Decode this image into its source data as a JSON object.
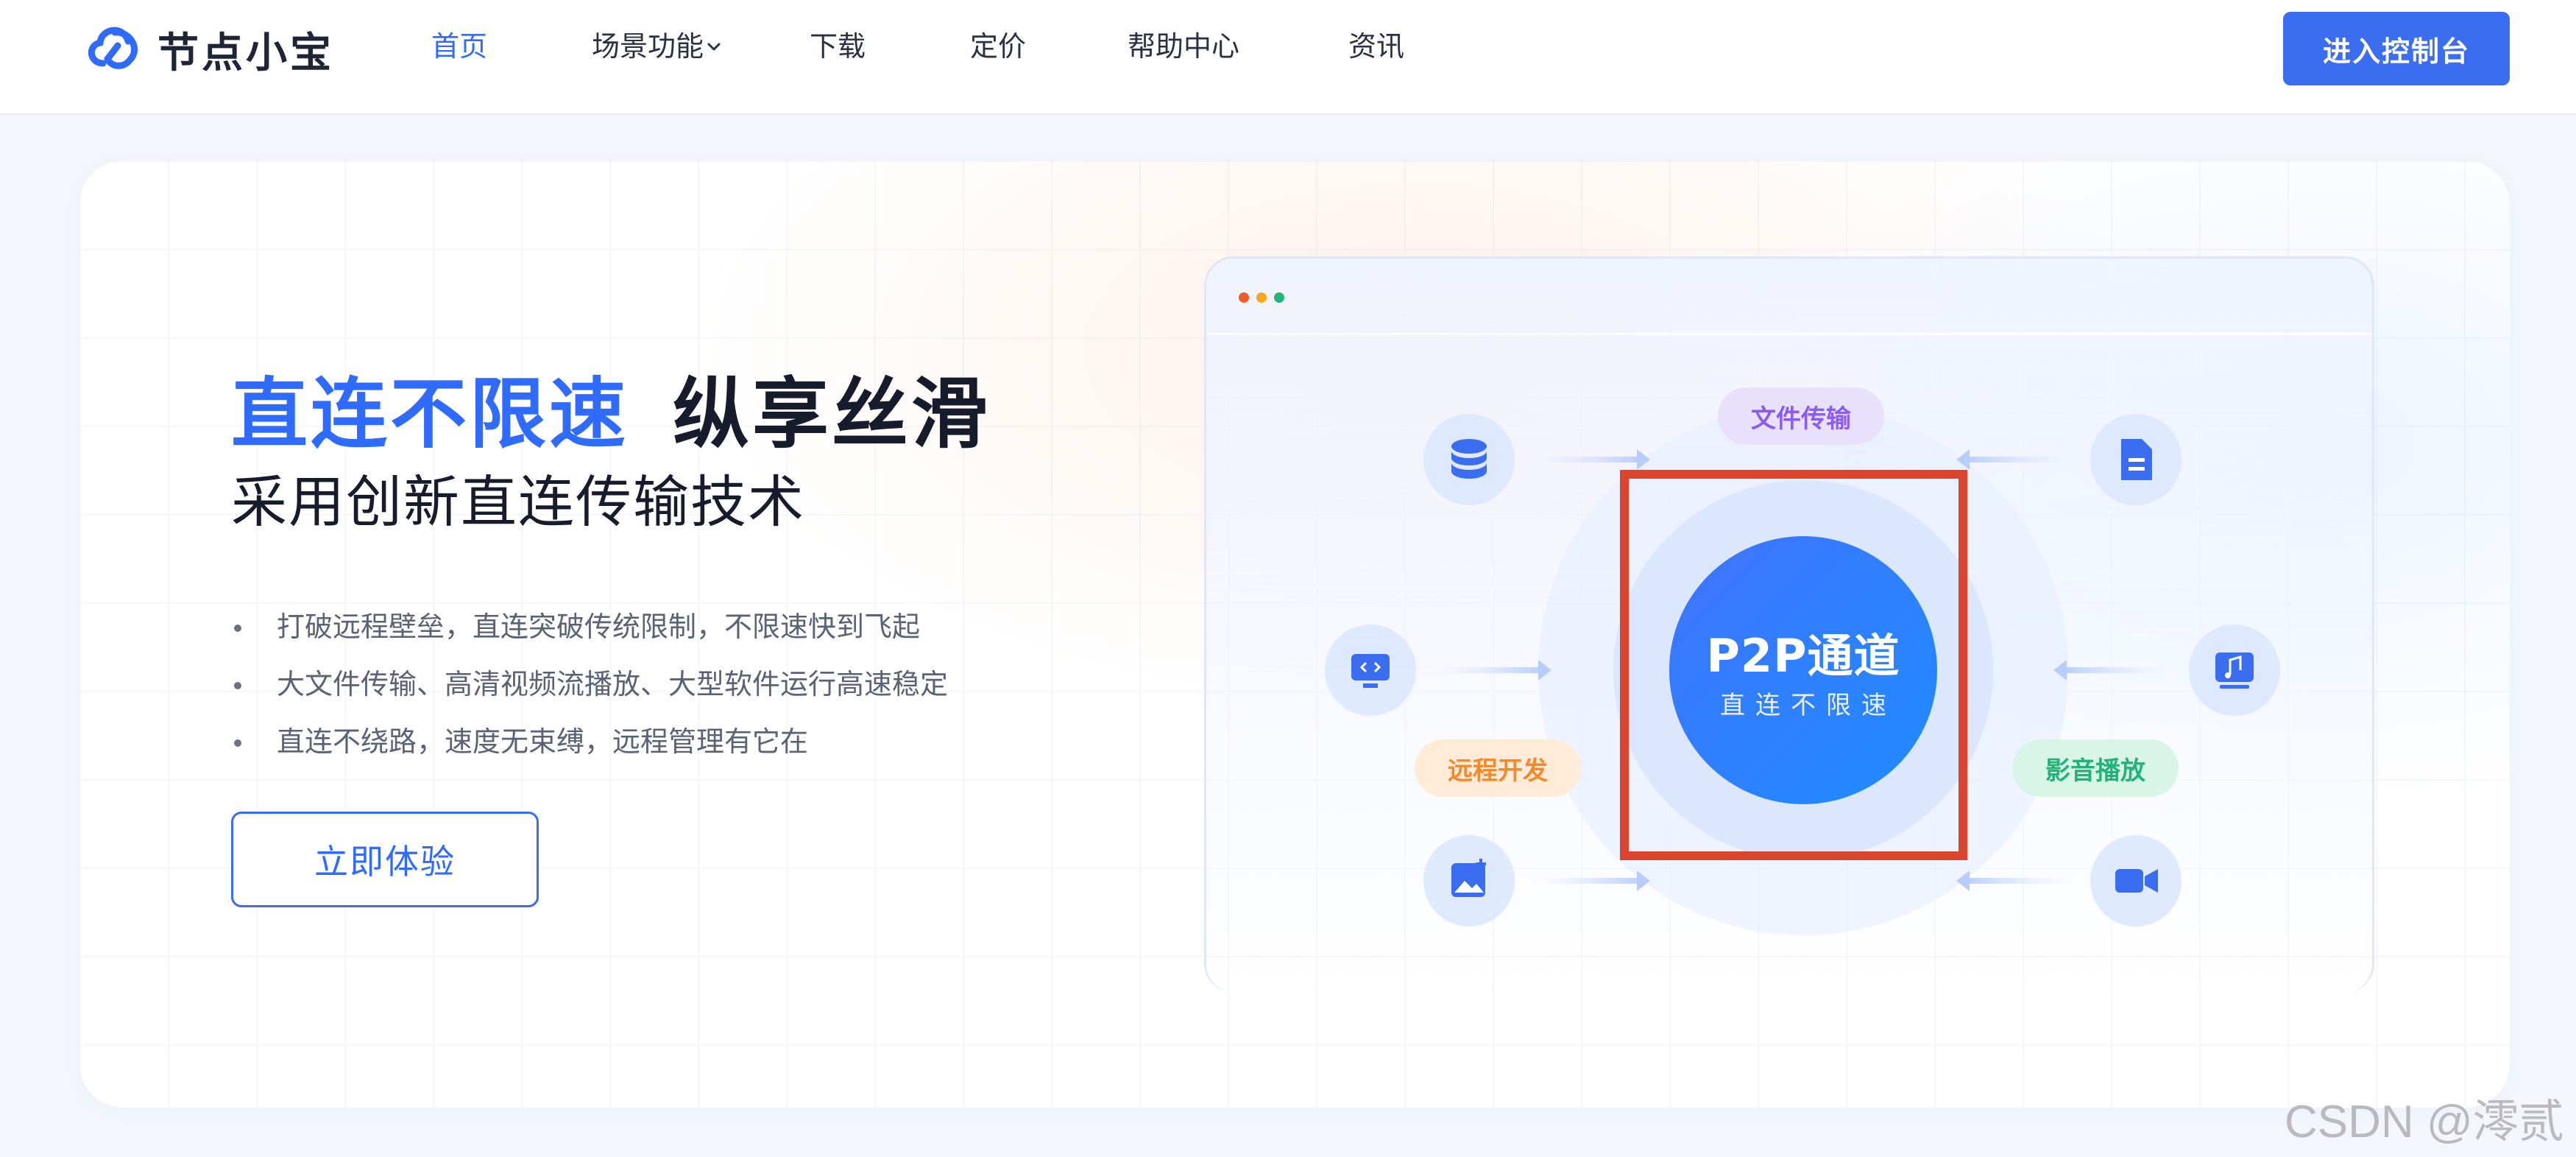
{
  "brand": {
    "name": "节点小宝",
    "logo_icon": "cloud-link-logo-icon",
    "color": "#2f6bff"
  },
  "nav": {
    "items": [
      {
        "label": "首页",
        "active": true
      },
      {
        "label": "场景功能",
        "has_dropdown": true,
        "dropdown_icon": "chevron-down-icon"
      },
      {
        "label": "下载"
      },
      {
        "label": "定价"
      },
      {
        "label": "帮助中心"
      },
      {
        "label": "资讯"
      }
    ],
    "console_button": "进入控制台"
  },
  "hero": {
    "headline_highlight": "直连不限速",
    "headline_rest": "纵享丝滑",
    "subheadline": "采用创新直连传输技术",
    "bullets": [
      "打破远程壁垒，直连突破传统限制，不限速快到飞起",
      "大文件传输、高清视频流播放、大型软件运行高速稳定",
      "直连不绕路，速度无束缚，远程管理有它在"
    ],
    "cta_button": "立即体验"
  },
  "illustration": {
    "window_dots": [
      "#f25a2a",
      "#f5a623",
      "#22b573"
    ],
    "tags": {
      "file_transfer": "文件传输",
      "remote_dev": "远程开发",
      "media_playback": "影音播放"
    },
    "center_title": "P2P通道",
    "center_subtitle": "直连不限速",
    "icons": [
      "database-icon",
      "document-icon",
      "remote-desktop-icon",
      "music-icon",
      "image-upload-icon",
      "video-camera-icon"
    ]
  },
  "watermark": "CSDN @澪贰",
  "colors": {
    "primary": "#3a6df0",
    "highlight_border": "#d9452f"
  }
}
